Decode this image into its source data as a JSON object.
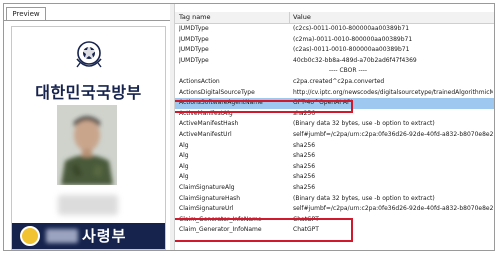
{
  "left_pane": {
    "tab_label": "Preview",
    "card": {
      "ministry_name": "대한민국국방부",
      "footer_text": "사령부"
    }
  },
  "table": {
    "headers": {
      "name": "Tag name",
      "value": "Value"
    },
    "rows": [
      {
        "name": "JUMDType",
        "value": "(c2cs)-0011-0010-800000aa00389b71"
      },
      {
        "name": "JUMDType",
        "value": "(c2ma)-0011-0010-800000aa00389b71"
      },
      {
        "name": "JUMDType",
        "value": "(c2as)-0011-0010-800000aa00389b71"
      },
      {
        "name": "JUMDType",
        "value": "40cb0c32-bb8a-489d-a70b2ad6f47f4369"
      },
      {
        "name": "",
        "value": "---- CBOR ----"
      },
      {
        "name": "ActionsAction",
        "value": "c2pa.created^c2pa.converted"
      },
      {
        "name": "ActionsDigitalSourceType",
        "value": "http://cv.iptc.org/newscodes/digitalsourcetype/trainedAlgorithmicMe"
      },
      {
        "name": "ActionsSoftwareAgentName",
        "value": "GPT-4o^OpenAI API"
      },
      {
        "name": "ActiveManifestAlg",
        "value": "sha256"
      },
      {
        "name": "ActiveManifestHash",
        "value": "(Binary data 32 bytes, use -b option to extract)"
      },
      {
        "name": "ActiveManifestUrl",
        "value": "self#jumbf=/c2pa/urn:c2pa:0fe36d26-92de-40fd-a832-b8070e8e28df"
      },
      {
        "name": "Alg",
        "value": "sha256"
      },
      {
        "name": "Alg",
        "value": "sha256"
      },
      {
        "name": "Alg",
        "value": "sha256"
      },
      {
        "name": "Alg",
        "value": "sha256"
      },
      {
        "name": "ClaimSignatureAlg",
        "value": "sha256"
      },
      {
        "name": "ClaimSignatureHash",
        "value": "(Binary data 32 bytes, use -b option to extract)"
      },
      {
        "name": "ClaimSignatureUrl",
        "value": "self#jumbf=/c2pa/urn:c2pa:0fe36d26-92de-40fd-a832-b8070e8e28df"
      },
      {
        "name": "Claim_Generator_InfoName",
        "value": "ChatGPT"
      },
      {
        "name": "Claim_Generator_InfoName",
        "value": "ChatGPT"
      }
    ],
    "selected_row_index": 7
  },
  "colors": {
    "highlight_border": "#d0192b",
    "selected_row": "#9fc8f0",
    "card_navy": "#16234d"
  }
}
